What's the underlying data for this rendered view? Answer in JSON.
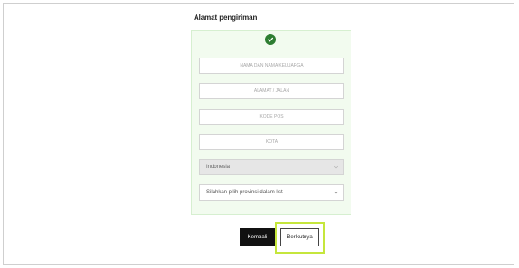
{
  "form": {
    "title": "Alamat pengiriman",
    "fields": {
      "name_placeholder": "NAMA DAN NAMA KELUARGA",
      "address_placeholder": "ALAMAT / JALAN",
      "postal_placeholder": "KODE POS",
      "city_placeholder": "KOTA"
    },
    "country_value": "Indonesia",
    "province_value": "Silahkan pilih provinsi dalam list"
  },
  "buttons": {
    "back_label": "Kembali",
    "next_label": "Berikutnya"
  },
  "colors": {
    "card_background": "#f2fbef",
    "check_icon": "#2e7d32",
    "highlight": "#c5e63c",
    "back_button": "#111111"
  },
  "icons": {
    "status": "check-circle-icon",
    "dropdown": "chevron-down-icon"
  }
}
